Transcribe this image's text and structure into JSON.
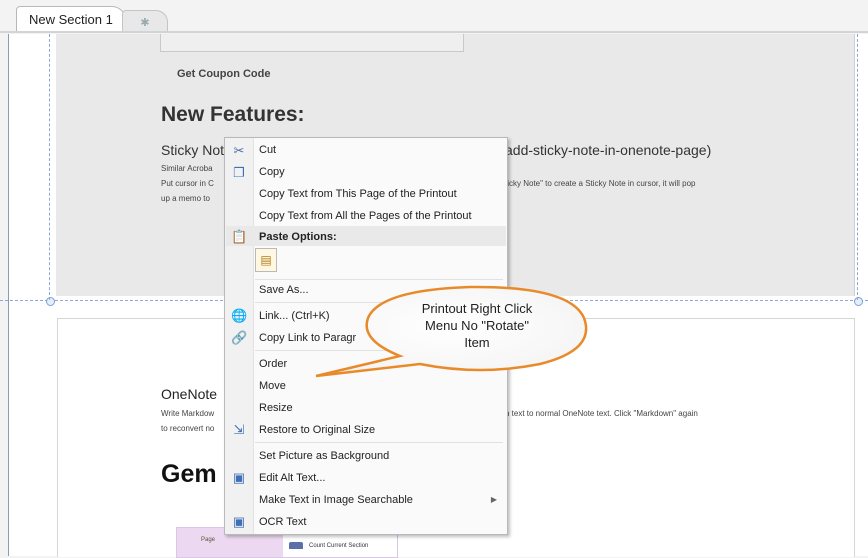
{
  "tabs": {
    "active": "New Section 1",
    "new_tab_glyph": "✱"
  },
  "page": {
    "coupon": "Get Coupon Code",
    "features_heading": "New Features:",
    "sticky_title_start": "Sticky Not",
    "sticky_title_end": "add-sticky-note-in-onenote-page)",
    "sticky_line1": "Similar Acroba",
    "sticky_line2_start": "Put cursor in C",
    "sticky_line2_end": "ticky Note\" to create a Sticky Note in cursor, it will pop",
    "sticky_line3": "up a memo to",
    "onenote_title": "OneNote",
    "markdown_line1_start": "Write Markdow",
    "markdown_line1_end": "n text to normal OneNote text. Click \"Markdown\" again",
    "markdown_line2": "to reconvert no",
    "gem_heading": "Gem",
    "thumb_page": "Page",
    "thumb_count": "Count Current Section"
  },
  "context_menu": {
    "cut": "Cut",
    "copy": "Copy",
    "copy_text_page": "Copy Text from This Page of the Printout",
    "copy_text_all": "Copy Text from All the Pages of the Printout",
    "paste_options": "Paste Options:",
    "save_as": "Save As...",
    "link": "Link...  (Ctrl+K)",
    "copy_link": "Copy Link to Paragr",
    "order": "Order",
    "move": "Move",
    "resize": "Resize",
    "restore": "Restore to Original Size",
    "set_background": "Set Picture as Background",
    "edit_alt": "Edit Alt Text...",
    "make_searchable": "Make Text in Image Searchable",
    "ocr": "OCR Text",
    "submenu_arrow": "▶"
  },
  "callout": {
    "line1": "Printout Right Click",
    "line2": "Menu No \"Rotate\"",
    "line3": "Item"
  },
  "icons": {
    "cut": "scissors-icon",
    "copy": "copy-icon",
    "paste": "paste-icon",
    "link": "link-icon",
    "copy_link": "copy-link-icon",
    "restore": "restore-size-icon",
    "edit_alt": "edit-alt-icon",
    "ocr": "ocr-icon"
  }
}
